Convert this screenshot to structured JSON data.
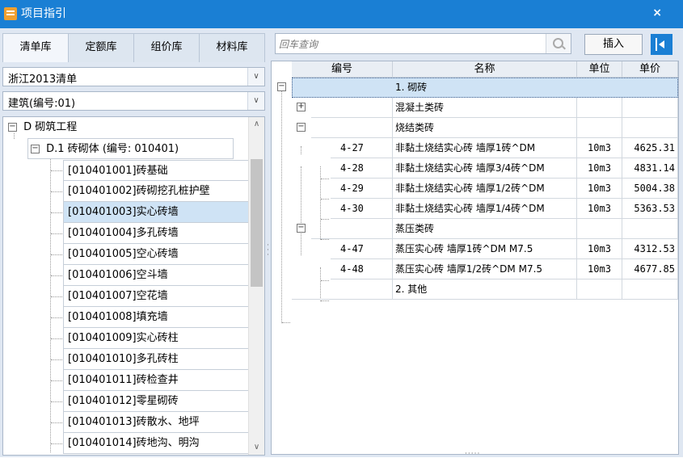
{
  "window": {
    "title": "项目指引",
    "close": "×"
  },
  "tabs": [
    "清单库",
    "定额库",
    "组价库",
    "材料库"
  ],
  "selects": {
    "library": "浙江2013清单",
    "category": "建筑(编号:01)"
  },
  "tree": {
    "root": {
      "toggle": "−",
      "label": "D 砌筑工程"
    },
    "child": {
      "toggle": "−",
      "label": "D.1 砖砌体 (编号: 010401)"
    },
    "leaves": [
      "[010401001]砖基础",
      "[010401002]砖砌挖孔桩护壁",
      "[010401003]实心砖墙",
      "[010401004]多孔砖墙",
      "[010401005]空心砖墙",
      "[010401006]空斗墙",
      "[010401007]空花墙",
      "[010401008]填充墙",
      "[010401009]实心砖柱",
      "[010401010]多孔砖柱",
      "[010401011]砖检查井",
      "[010401012]零星砌砖",
      "[010401013]砖散水、地坪",
      "[010401014]砖地沟、明沟"
    ],
    "selected_index": 2
  },
  "search": {
    "placeholder": "回车查询"
  },
  "buttons": {
    "insert": "插入"
  },
  "grid": {
    "headers": {
      "code": "编号",
      "name": "名称",
      "unit": "单位",
      "price": "单价"
    },
    "rows": [
      {
        "code": "",
        "name": "1. 砌砖",
        "unit": "",
        "price": "",
        "toggle": "−"
      },
      {
        "code": "",
        "name": "混凝土类砖",
        "unit": "",
        "price": "",
        "toggle": "+"
      },
      {
        "code": "",
        "name": "烧结类砖",
        "unit": "",
        "price": "",
        "toggle": "−"
      },
      {
        "code": "4-27",
        "name": "非黏土烧结实心砖 墙厚1砖^DM",
        "unit": "10m3",
        "price": "4625.31"
      },
      {
        "code": "4-28",
        "name": "非黏土烧结实心砖 墙厚3/4砖^DM",
        "unit": "10m3",
        "price": "4831.14"
      },
      {
        "code": "4-29",
        "name": "非黏土烧结实心砖 墙厚1/2砖^DM",
        "unit": "10m3",
        "price": "5004.38"
      },
      {
        "code": "4-30",
        "name": "非黏土烧结实心砖 墙厚1/4砖^DM",
        "unit": "10m3",
        "price": "5363.53"
      },
      {
        "code": "",
        "name": "蒸压类砖",
        "unit": "",
        "price": "",
        "toggle": "−"
      },
      {
        "code": "4-47",
        "name": "蒸压实心砖 墙厚1砖^DM M7.5",
        "unit": "10m3",
        "price": "4312.53"
      },
      {
        "code": "4-48",
        "name": "蒸压实心砖 墙厚1/2砖^DM M7.5",
        "unit": "10m3",
        "price": "4677.85"
      },
      {
        "code": "",
        "name": "2. 其他",
        "unit": "",
        "price": ""
      }
    ]
  }
}
